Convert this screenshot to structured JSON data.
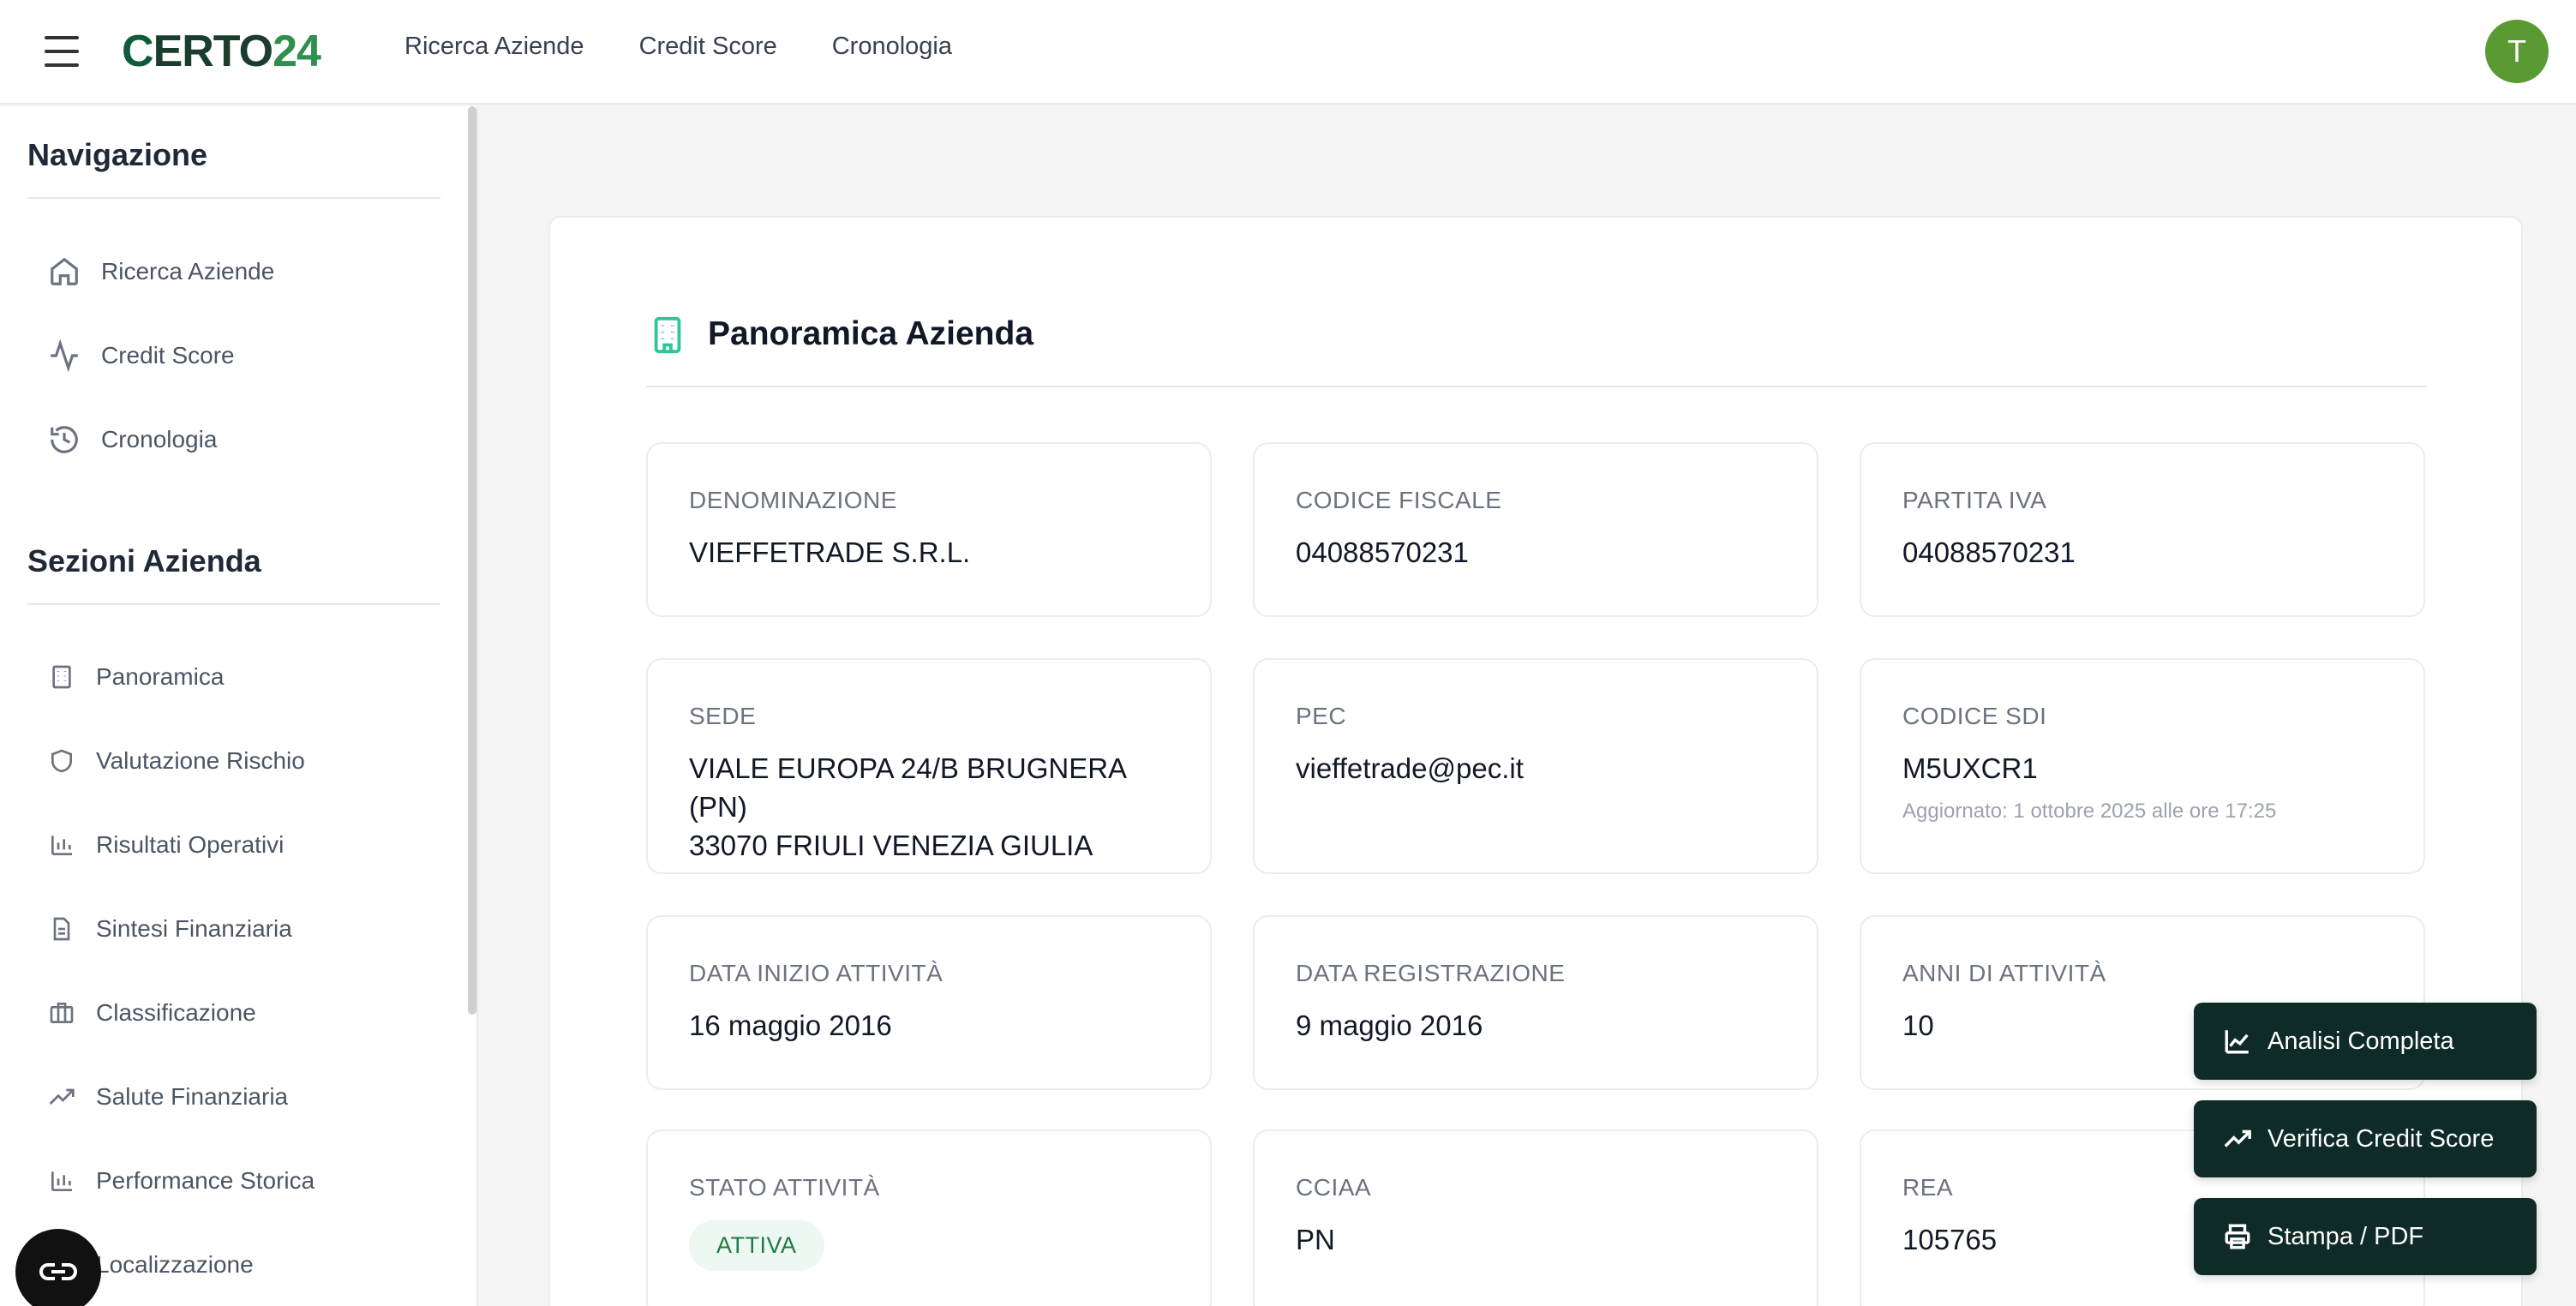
{
  "header": {
    "logo_c": "C",
    "logo_text": "ERTO",
    "logo_num": "24",
    "nav": [
      "Ricerca Aziende",
      "Credit Score",
      "Cronologia"
    ],
    "avatar_initial": "T"
  },
  "sidebar": {
    "nav_heading": "Navigazione",
    "nav_items": [
      {
        "label": "Ricerca Aziende",
        "icon": "home-icon"
      },
      {
        "label": "Credit Score",
        "icon": "activity-icon"
      },
      {
        "label": "Cronologia",
        "icon": "history-icon"
      }
    ],
    "sections_heading": "Sezioni Azienda",
    "section_items": [
      {
        "label": "Panoramica",
        "icon": "building-icon"
      },
      {
        "label": "Valutazione Rischio",
        "icon": "shield-icon"
      },
      {
        "label": "Risultati Operativi",
        "icon": "bar-chart-icon"
      },
      {
        "label": "Sintesi Finanziaria",
        "icon": "document-icon"
      },
      {
        "label": "Classificazione",
        "icon": "briefcase-icon"
      },
      {
        "label": "Salute Finanziaria",
        "icon": "trending-up-icon"
      },
      {
        "label": "Performance Storica",
        "icon": "bar-chart-icon"
      },
      {
        "label": "Localizzazione",
        "icon": "map-pin-icon"
      }
    ]
  },
  "main": {
    "title": "Panoramica Azienda",
    "fields": {
      "denominazione": {
        "label": "DENOMINAZIONE",
        "value": "VIEFFETRADE S.R.L."
      },
      "codice_fiscale": {
        "label": "CODICE FISCALE",
        "value": "04088570231"
      },
      "partita_iva": {
        "label": "PARTITA IVA",
        "value": "04088570231"
      },
      "sede": {
        "label": "SEDE",
        "value_line1": "VIALE EUROPA 24/B BRUGNERA (PN)",
        "value_line2": "33070 FRIULI VENEZIA GIULIA"
      },
      "pec": {
        "label": "PEC",
        "value": "vieffetrade@pec.it"
      },
      "codice_sdi": {
        "label": "CODICE SDI",
        "value": "M5UXCR1",
        "note": "Aggiornato: 1 ottobre 2025 alle ore 17:25"
      },
      "data_inizio": {
        "label": "DATA INIZIO ATTIVITÀ",
        "value": "16 maggio 2016"
      },
      "data_registrazione": {
        "label": "DATA REGISTRAZIONE",
        "value": "9 maggio 2016"
      },
      "anni_attivita": {
        "label": "ANNI DI ATTIVITÀ",
        "value": "10"
      },
      "stato_attivita": {
        "label": "STATO ATTIVITÀ",
        "value": "ATTIVA"
      },
      "cciaa": {
        "label": "CCIAA",
        "value": "PN"
      },
      "rea": {
        "label": "REA",
        "value": "105765"
      }
    }
  },
  "actions": {
    "analisi": "Analisi Completa",
    "verifica": "Verifica Credit Score",
    "stampa": "Stampa / PDF"
  }
}
